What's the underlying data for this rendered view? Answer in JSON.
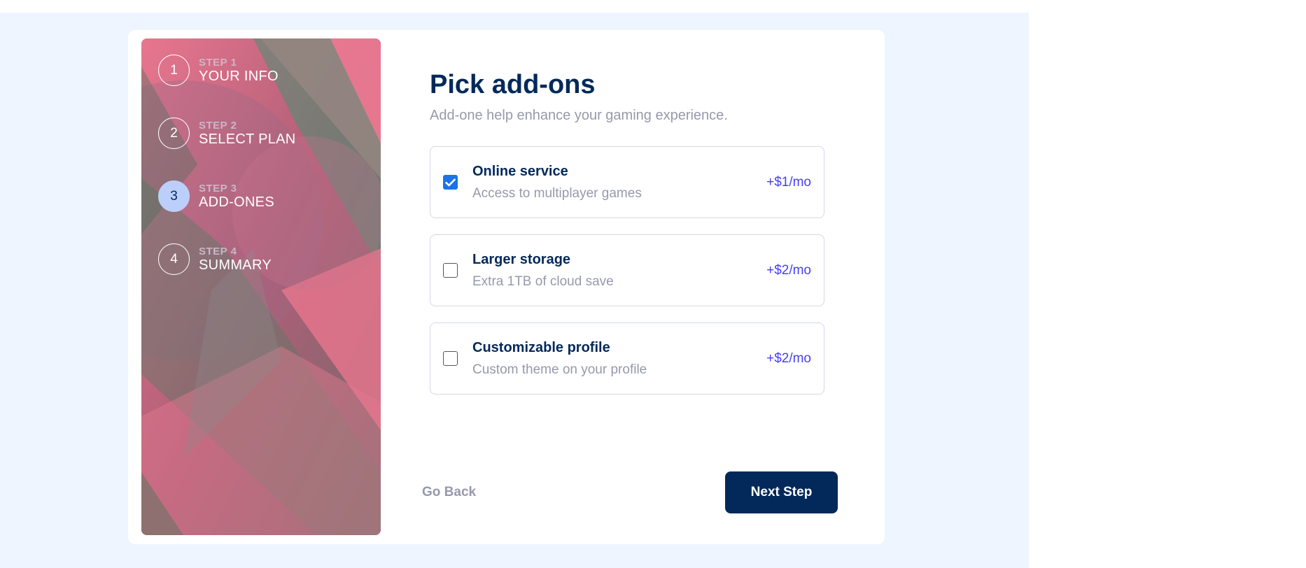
{
  "sidebar": {
    "steps": [
      {
        "number": "1",
        "step": "STEP 1",
        "label": "YOUR INFO",
        "active": false
      },
      {
        "number": "2",
        "step": "STEP 2",
        "label": "SELECT PLAN",
        "active": false
      },
      {
        "number": "3",
        "step": "STEP 3",
        "label": "ADD-ONES",
        "active": true
      },
      {
        "number": "4",
        "step": "STEP 4",
        "label": "SUMMARY",
        "active": false
      }
    ]
  },
  "main": {
    "title": "Pick add-ons",
    "subtitle": "Add-one help enhance your gaming experience.",
    "addons": [
      {
        "name": "Online service",
        "description": "Access to multiplayer games",
        "price": "+$1/mo",
        "checked": true
      },
      {
        "name": "Larger storage",
        "description": "Extra 1TB of cloud save",
        "price": "+$2/mo",
        "checked": false
      },
      {
        "name": "Customizable profile",
        "description": "Custom theme on your profile",
        "price": "+$2/mo",
        "checked": false
      }
    ],
    "back_label": "Go Back",
    "next_label": "Next Step"
  },
  "colors": {
    "page_background": "#eef5ff",
    "marine_blue": "#02295a",
    "purplish_blue": "#473dff",
    "light_blue_active": "#bccffa",
    "checkbox_blue": "#1a73e8"
  }
}
